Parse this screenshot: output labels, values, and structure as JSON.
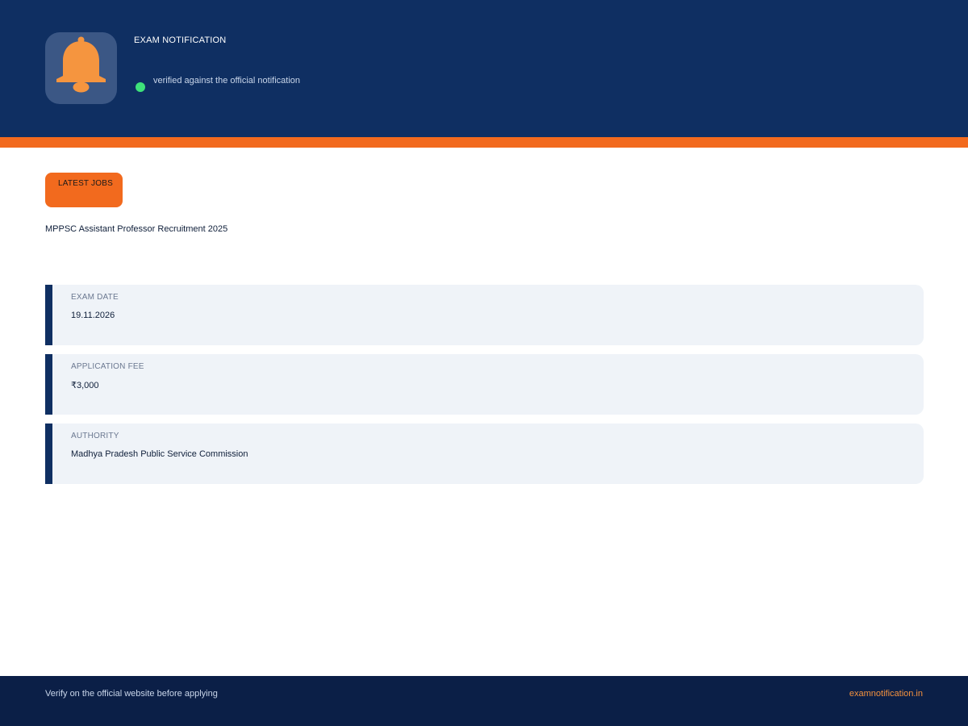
{
  "header": {
    "title": "EXAM NOTIFICATION",
    "status_text": "verified against the official notification",
    "logo_icon": "bell-icon"
  },
  "colors": {
    "brand_navy": "#0f2f62",
    "accent_orange": "#f26a1e",
    "status_green": "#3ee27a",
    "card_background": "#eff3f8"
  },
  "badge": {
    "label": "LATEST JOBS"
  },
  "job": {
    "title": "MPPSC Assistant Professor Recruitment 2025"
  },
  "details": [
    {
      "label": "EXAM DATE",
      "value": "19.11.2026"
    },
    {
      "label": "APPLICATION FEE",
      "value": "₹3,000"
    },
    {
      "label": "AUTHORITY",
      "value": "Madhya Pradesh Public Service Commission"
    }
  ],
  "footer": {
    "note": "Verify on the official website before applying",
    "site": "examnotification.in"
  }
}
